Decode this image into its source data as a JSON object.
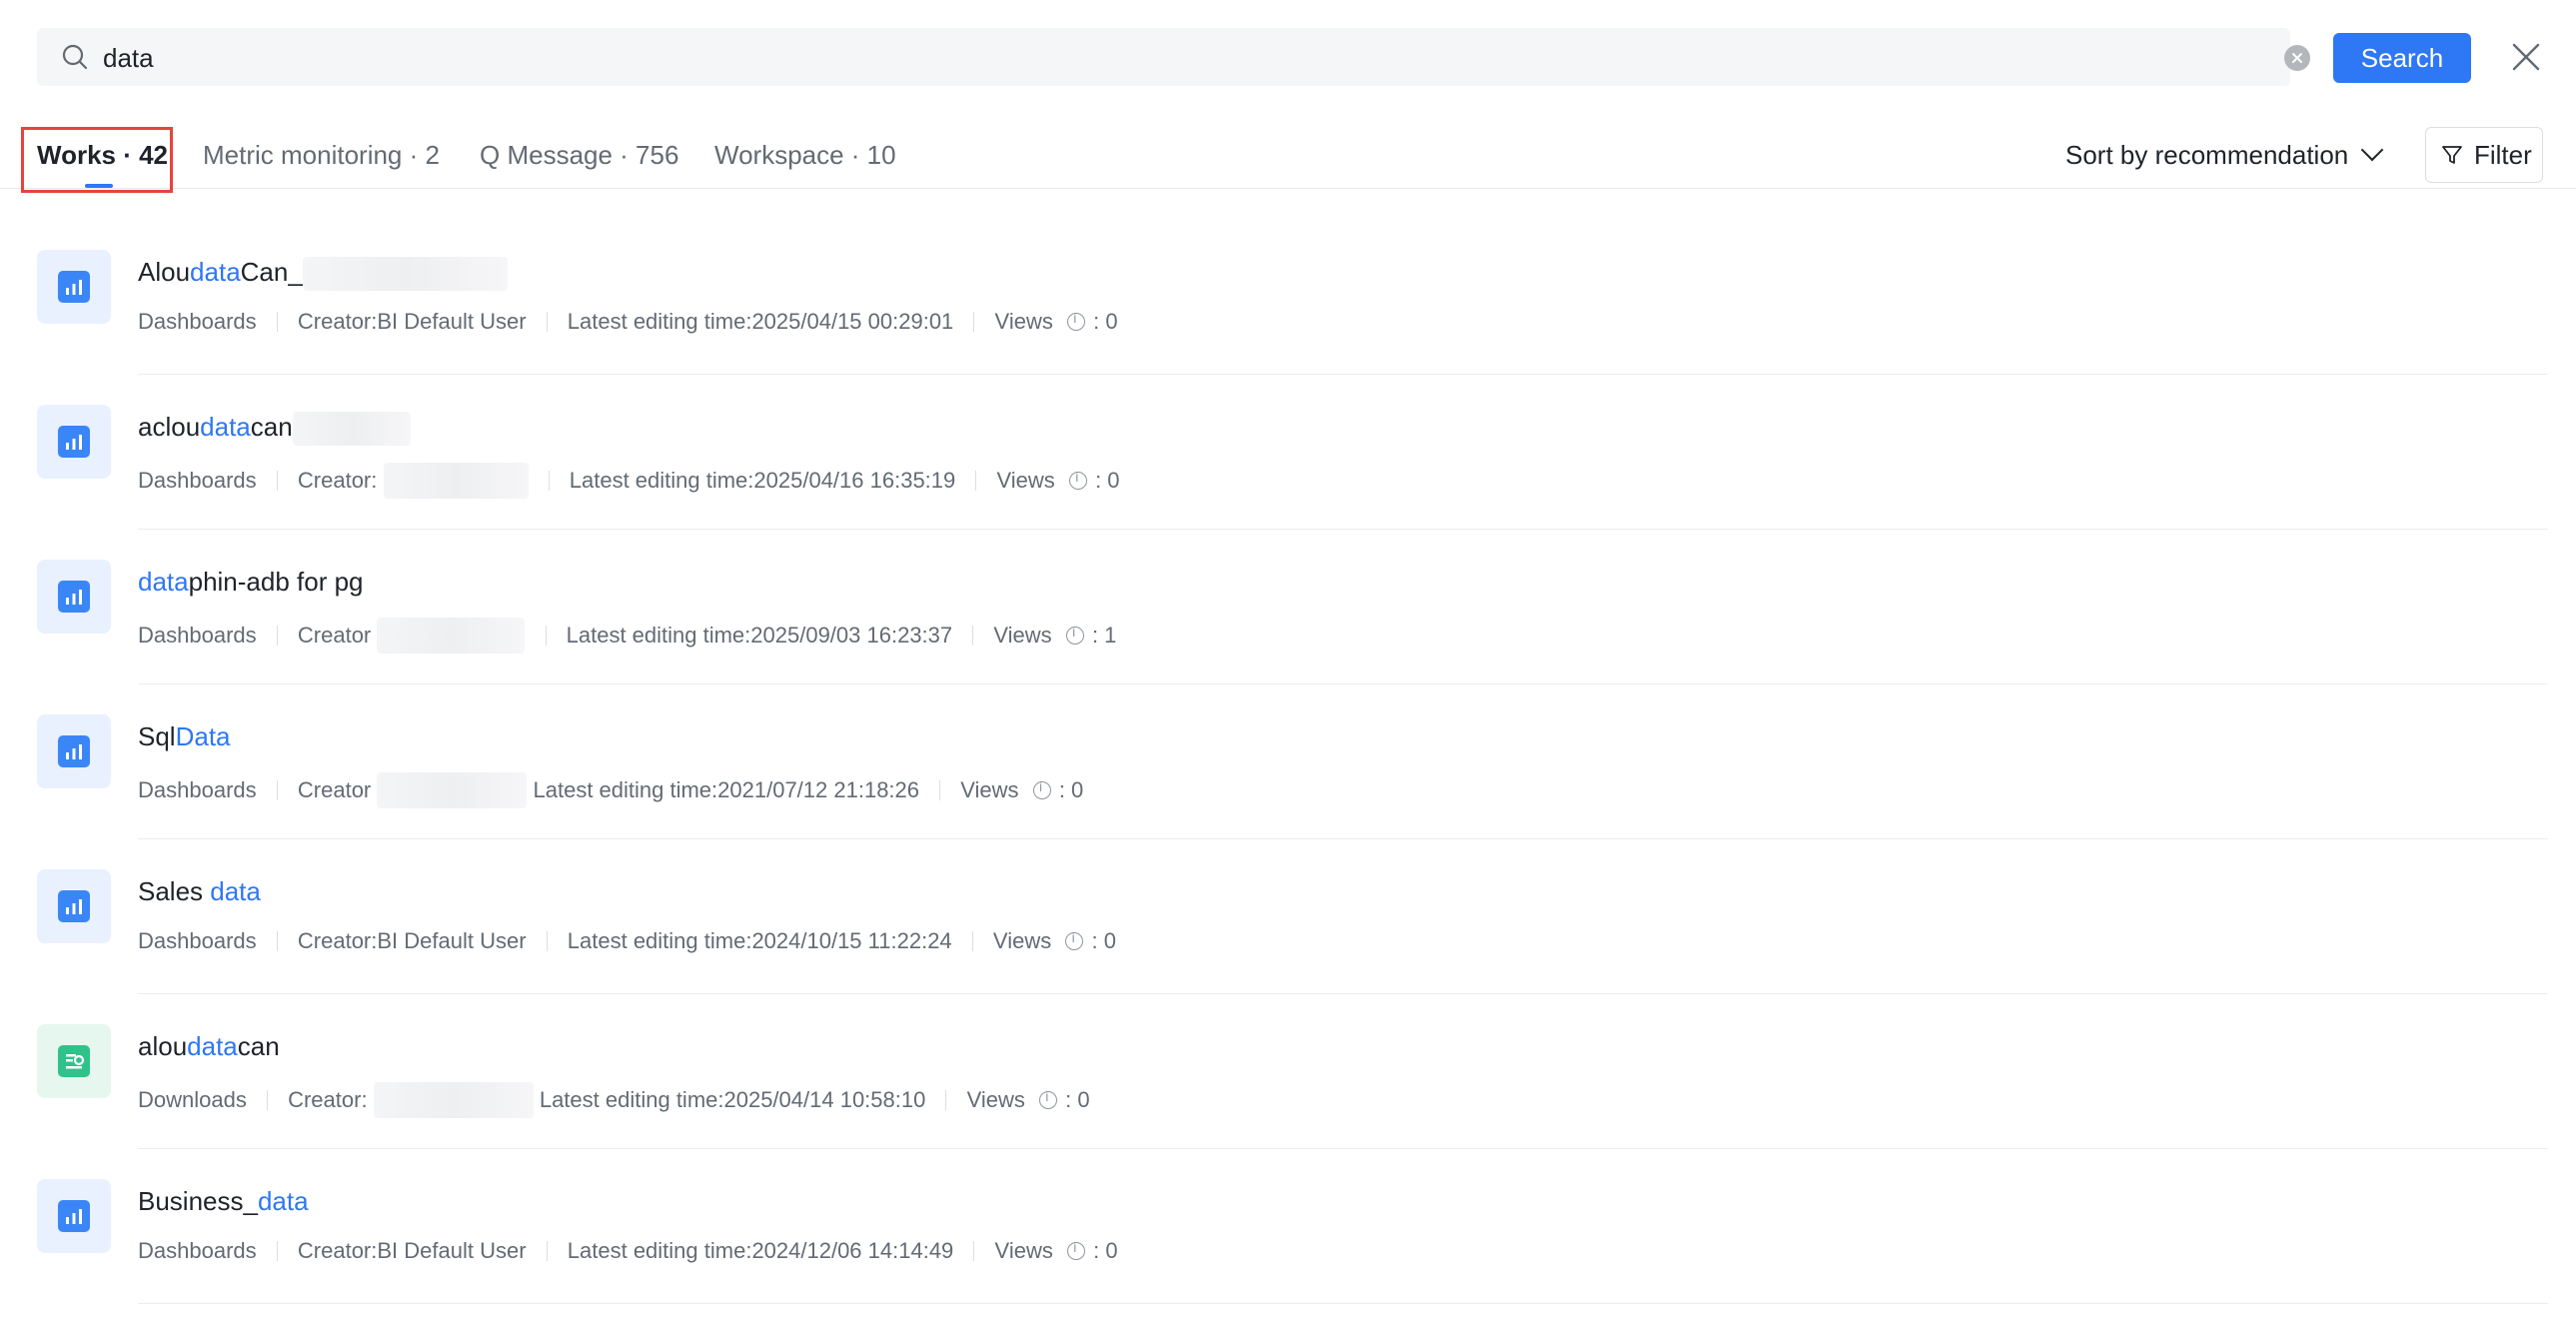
{
  "search": {
    "value": "data",
    "button_label": "Search"
  },
  "tabs": [
    {
      "label": "Works · 42",
      "active": true
    },
    {
      "label": "Metric monitoring · 2",
      "active": false
    },
    {
      "label": "Q Message · 756",
      "active": false
    },
    {
      "label": "Workspace · 10",
      "active": false
    }
  ],
  "sort_label": "Sort by recommendation",
  "filter_label": "Filter",
  "icons": {
    "search": "search-icon",
    "clear": "clear-icon",
    "close": "close-icon",
    "chevron": "chevron-down-icon",
    "filter": "filter-icon",
    "dashboard": "bar-chart-icon",
    "download": "download-report-icon",
    "info": "info-icon"
  },
  "colors": {
    "accent": "#2e77f5",
    "highlight_border": "#e8433b",
    "dashboard_icon": "#3a86f7",
    "download_icon": "#2fc28a"
  },
  "results": [
    {
      "title_pre": "Alou",
      "title_hl": "data",
      "title_post": "Can_",
      "type": "Dashboards",
      "creator": "Creator:BI Default User",
      "edited": "Latest editing time:2025/04/15 00:29:01",
      "views_label": "Views",
      "views": ": 0",
      "icon": "dashboard"
    },
    {
      "title_pre": "aclou",
      "title_hl": "data",
      "title_post": "can",
      "type": "Dashboards",
      "creator": "Creator:",
      "edited": "Latest editing time:2025/04/16 16:35:19",
      "views_label": "Views",
      "views": ": 0",
      "icon": "dashboard"
    },
    {
      "title_pre": "",
      "title_hl": "data",
      "title_post": "phin-adb for pg",
      "type": "Dashboards",
      "creator": "Creator",
      "edited": "Latest editing time:2025/09/03 16:23:37",
      "views_label": "Views",
      "views": ": 1",
      "icon": "dashboard"
    },
    {
      "title_pre": "Sql",
      "title_hl": "Data",
      "title_post": "",
      "type": "Dashboards",
      "creator": "Creator",
      "edited": "Latest editing time:2021/07/12 21:18:26",
      "views_label": "Views",
      "views": ": 0",
      "icon": "dashboard"
    },
    {
      "title_pre": "Sales ",
      "title_hl": "data",
      "title_post": "",
      "type": "Dashboards",
      "creator": "Creator:BI Default User",
      "edited": "Latest editing time:2024/10/15 11:22:24",
      "views_label": "Views",
      "views": ": 0",
      "icon": "dashboard"
    },
    {
      "title_pre": "alou",
      "title_hl": "data",
      "title_post": "can",
      "type": "Downloads",
      "creator": "Creator:",
      "edited": "Latest editing time:2025/04/14 10:58:10",
      "views_label": "Views",
      "views": ": 0",
      "icon": "download"
    },
    {
      "title_pre": "Business_",
      "title_hl": "data",
      "title_post": "",
      "type": "Dashboards",
      "creator": "Creator:BI Default User",
      "edited": "Latest editing time:2024/12/06 14:14:49",
      "views_label": "Views",
      "views": ": 0",
      "icon": "dashboard"
    }
  ]
}
